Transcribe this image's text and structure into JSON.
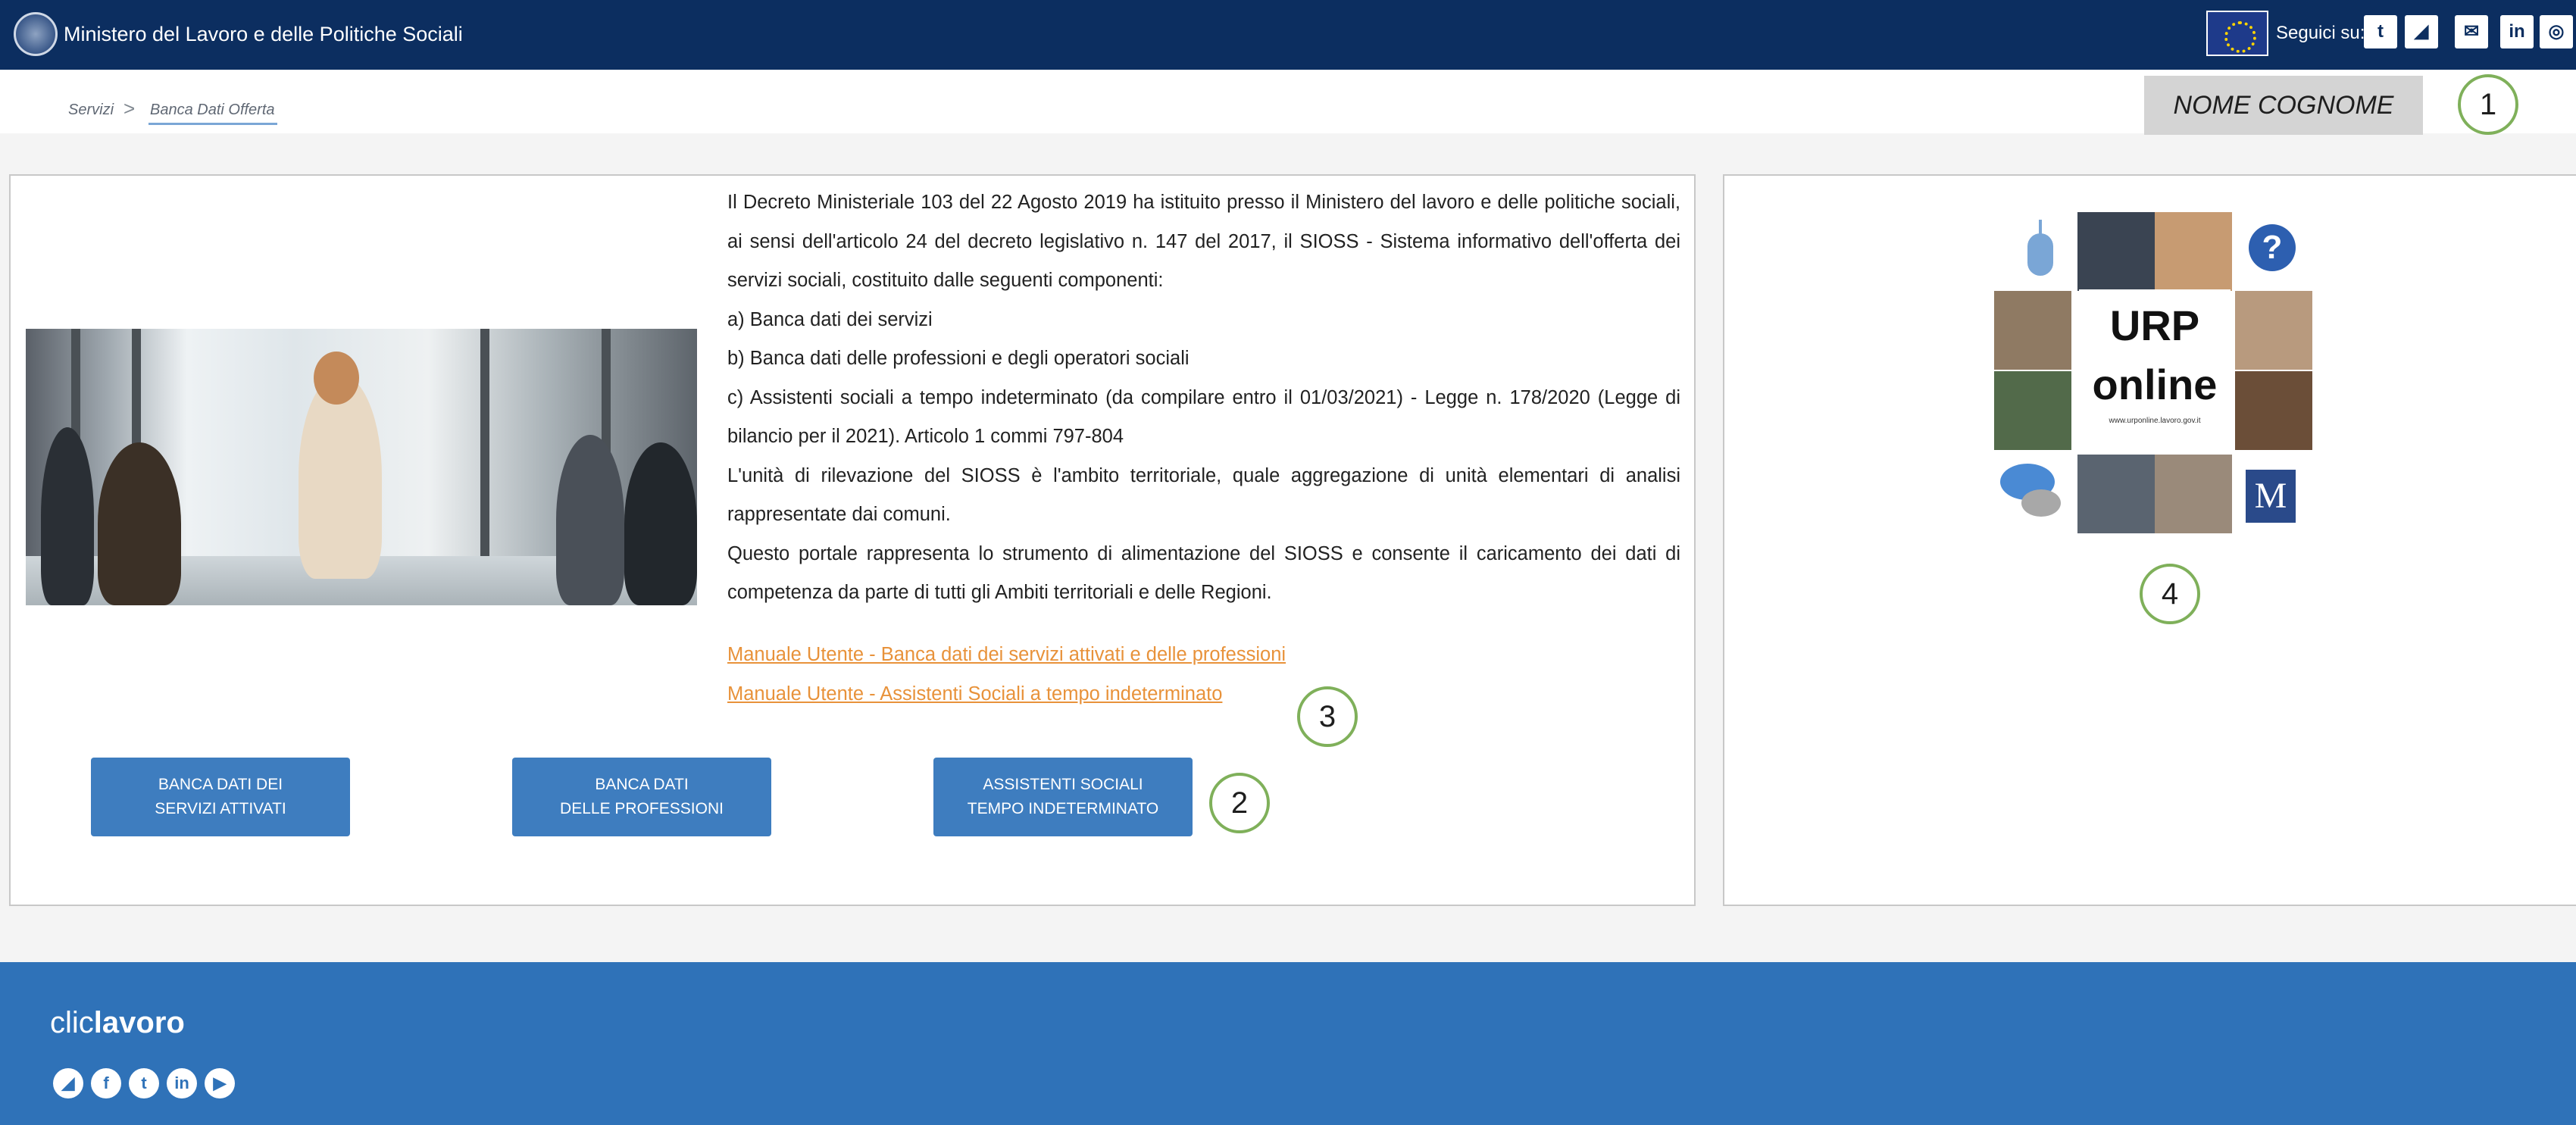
{
  "header": {
    "ministry_title": "Ministero del Lavoro e delle Politiche Sociali",
    "follow_label": "Seguici su:",
    "social_icons": [
      "twitter-icon",
      "rss-icon",
      "mail-icon",
      "linkedin-icon",
      "instagram-icon"
    ],
    "social_glyphs": [
      "t",
      "◢",
      "✉",
      "in",
      "◎"
    ],
    "bg_color": "#0c2e60"
  },
  "breadcrumb": {
    "items": [
      "Servizi",
      "Banca Dati Offerta"
    ],
    "separator": ">"
  },
  "user": {
    "name": "NOME COGNOME"
  },
  "callouts": [
    "1",
    "2",
    "3",
    "4"
  ],
  "intro": {
    "paragraphs": [
      "Il Decreto Ministeriale 103 del 22 Agosto 2019 ha istituito presso il Ministero del lavoro e delle politiche sociali, ai sensi dell'articolo 24 del decreto legislativo n. 147 del 2017, il SIOSS - Sistema informativo dell'offerta dei servizi sociali, costituito dalle seguenti componenti:",
      "a) Banca dati dei servizi",
      "b) Banca dati delle professioni e degli operatori sociali",
      "c) Assistenti sociali a tempo indeterminato (da compilare entro il 01/03/2021) - Legge n. 178/2020 (Legge di bilancio per il 2021). Articolo 1 commi 797-804",
      "L'unità di rilevazione del SIOSS è l'ambito territoriale, quale aggregazione di unità elementari di analisi rappresentate dai comuni.",
      "Questo portale rappresenta lo strumento di alimentazione del SIOSS e consente il caricamento dei dati di competenza da parte di tutti gli Ambiti territoriali e delle Regioni."
    ]
  },
  "manuals": [
    "Manuale Utente - Banca dati dei servizi attivati e delle professioni",
    "Manuale Utente - Assistenti Sociali a tempo indeterminato"
  ],
  "buttons": [
    {
      "line1": "Banca dati dei",
      "line2": "servizi attivati"
    },
    {
      "line1": "Banca dati",
      "line2": "delle professioni"
    },
    {
      "line1": "Assistenti sociali",
      "line2": "tempo indeterminato"
    }
  ],
  "urp": {
    "title_line1": "URP",
    "title_line2": "online",
    "url": "www.urponline.lavoro.gov.it",
    "question_glyph": "?",
    "m_glyph": "M"
  },
  "footer": {
    "brand_light": "clic",
    "brand_bold": "lavoro",
    "social_icons": [
      "rss-icon",
      "facebook-icon",
      "twitter-icon",
      "linkedin-icon",
      "youtube-icon"
    ],
    "social_glyphs": [
      "◢",
      "f",
      "t",
      "in",
      "▶"
    ],
    "bg_color": "#2f72b8"
  },
  "colors": {
    "accent_button": "#3e7dbf",
    "link": "#e8923a",
    "callout_ring": "#7fb05a"
  }
}
